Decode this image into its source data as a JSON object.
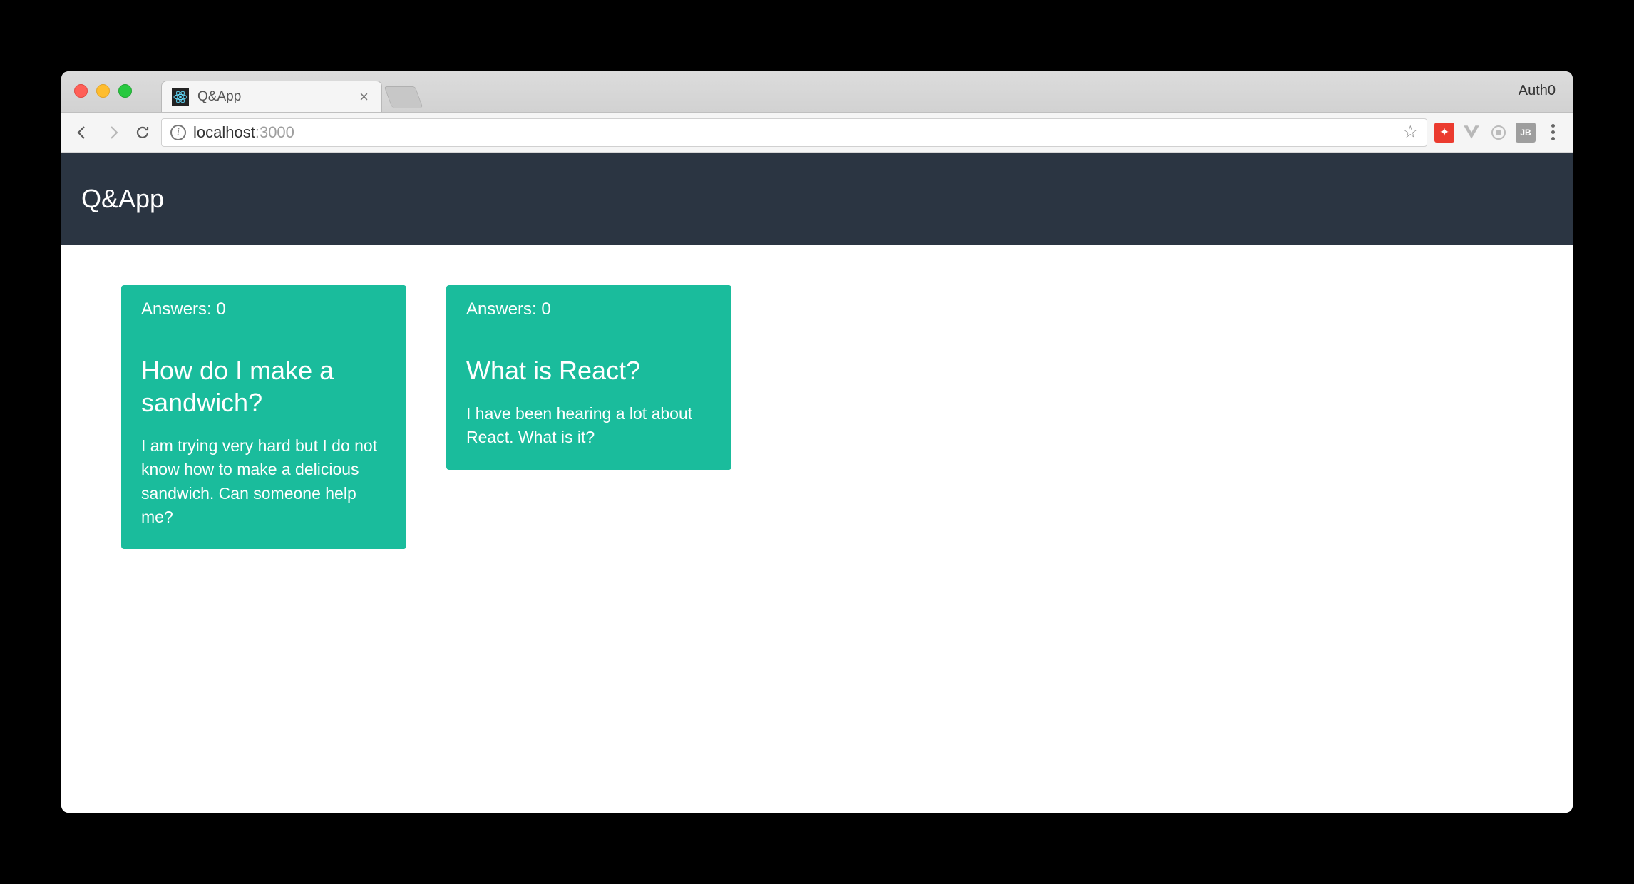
{
  "browser": {
    "profile_label": "Auth0",
    "tab": {
      "title": "Q&App"
    },
    "url": {
      "host": "localhost",
      "port": ":3000"
    }
  },
  "page": {
    "navbar": {
      "brand": "Q&App"
    },
    "cards": [
      {
        "answers_label": "Answers: 0",
        "title": "How do I make a sandwich?",
        "body": "I am trying very hard but I do not know how to make a delicious sandwich. Can someone help me?"
      },
      {
        "answers_label": "Answers: 0",
        "title": "What is React?",
        "body": "I have been hearing a lot about React. What is it?"
      }
    ]
  }
}
